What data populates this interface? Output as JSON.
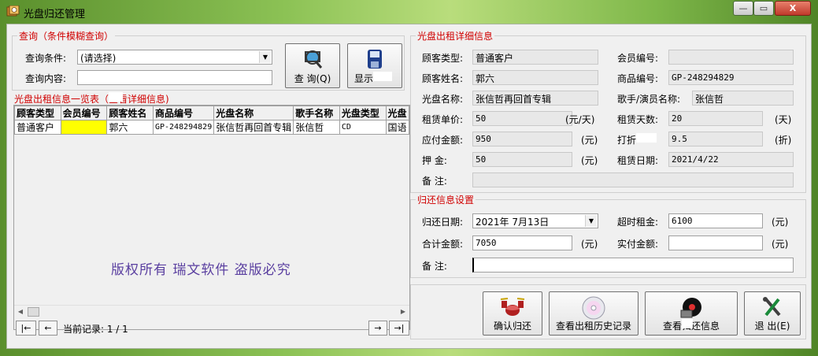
{
  "window": {
    "title": "光盘归还管理",
    "controls": {
      "minimize": "—",
      "maximize": "▭",
      "close": "X"
    }
  },
  "query": {
    "group_title": "查询（条件模糊查询）",
    "condition_label": "查询条件:",
    "condition_value": "(请选择)",
    "content_label": "查询内容:",
    "content_value": "",
    "search_button": "查 询(Q)",
    "show_button": "显示"
  },
  "list": {
    "group_title_a": "光盘出租信息一览表（",
    "group_title_b": "查看详细信息)",
    "columns": [
      "顾客类型",
      "会员编号",
      "顾客姓名",
      "商品编号",
      "光盘名称",
      "歌手名称",
      "光盘类型",
      "光盘"
    ],
    "rows": [
      [
        "普通客户",
        "",
        "郭六",
        "GP-248294829",
        "张信哲再回首专辑",
        "张信哲",
        "CD",
        "国语"
      ]
    ],
    "watermark": "版权所有  瑞文软件  盗版必究",
    "nav_first": "|←",
    "nav_prev": "←",
    "record_label": "当前记录: 1 / 1",
    "nav_next": "→",
    "nav_last": "→|"
  },
  "detail": {
    "group_title": "光盘出租详细信息",
    "customer_type_label": "顾客类型:",
    "customer_type": "普通客户",
    "member_no_label": "会员编号:",
    "member_no": "",
    "customer_name_label": "顾客姓名:",
    "customer_name": "郭六",
    "product_no_label": "商品编号:",
    "product_no": "GP-248294829",
    "disc_name_label": "光盘名称:",
    "disc_name": "张信哲再回首专辑",
    "singer_label": "歌手/演员名称:",
    "singer": "张信哲",
    "unit_price_label": "租赁单价:",
    "unit_price": "50",
    "unit_price_unit": "(元/天)",
    "days_label": "租赁天数:",
    "days": "20",
    "days_unit": "(天)",
    "payable_label": "应付金额:",
    "payable": "950",
    "payable_unit": "(元)",
    "discount_label": "打折",
    "discount": "9.5",
    "discount_unit": "(折)",
    "deposit_label": "押    金:",
    "deposit": "50",
    "deposit_unit": "(元)",
    "rent_date_label": "租赁日期:",
    "rent_date": "2021/4/22",
    "remark_label": "备    注:",
    "remark": ""
  },
  "return": {
    "group_title": "归还信息设置",
    "return_date_label": "归还日期:",
    "return_date": "2021年 7月13日",
    "overdue_label": "超时租金:",
    "overdue": "6100",
    "overdue_unit": "(元)",
    "total_label": "合计金额:",
    "total": "7050",
    "total_unit": "(元)",
    "actual_label": "实付金额:",
    "actual": "",
    "actual_unit": "(元)",
    "remark_label": "备    注:",
    "remark": ""
  },
  "actions": {
    "confirm": "确认归还",
    "history": "查看出租历史记录",
    "view_a": "查看",
    "view_b": "归还信息",
    "exit": "退 出(E)"
  },
  "colors": {
    "group_title": "#d00000",
    "highlight_cell": "#ffff00",
    "watermark": "#5a3fa0"
  }
}
